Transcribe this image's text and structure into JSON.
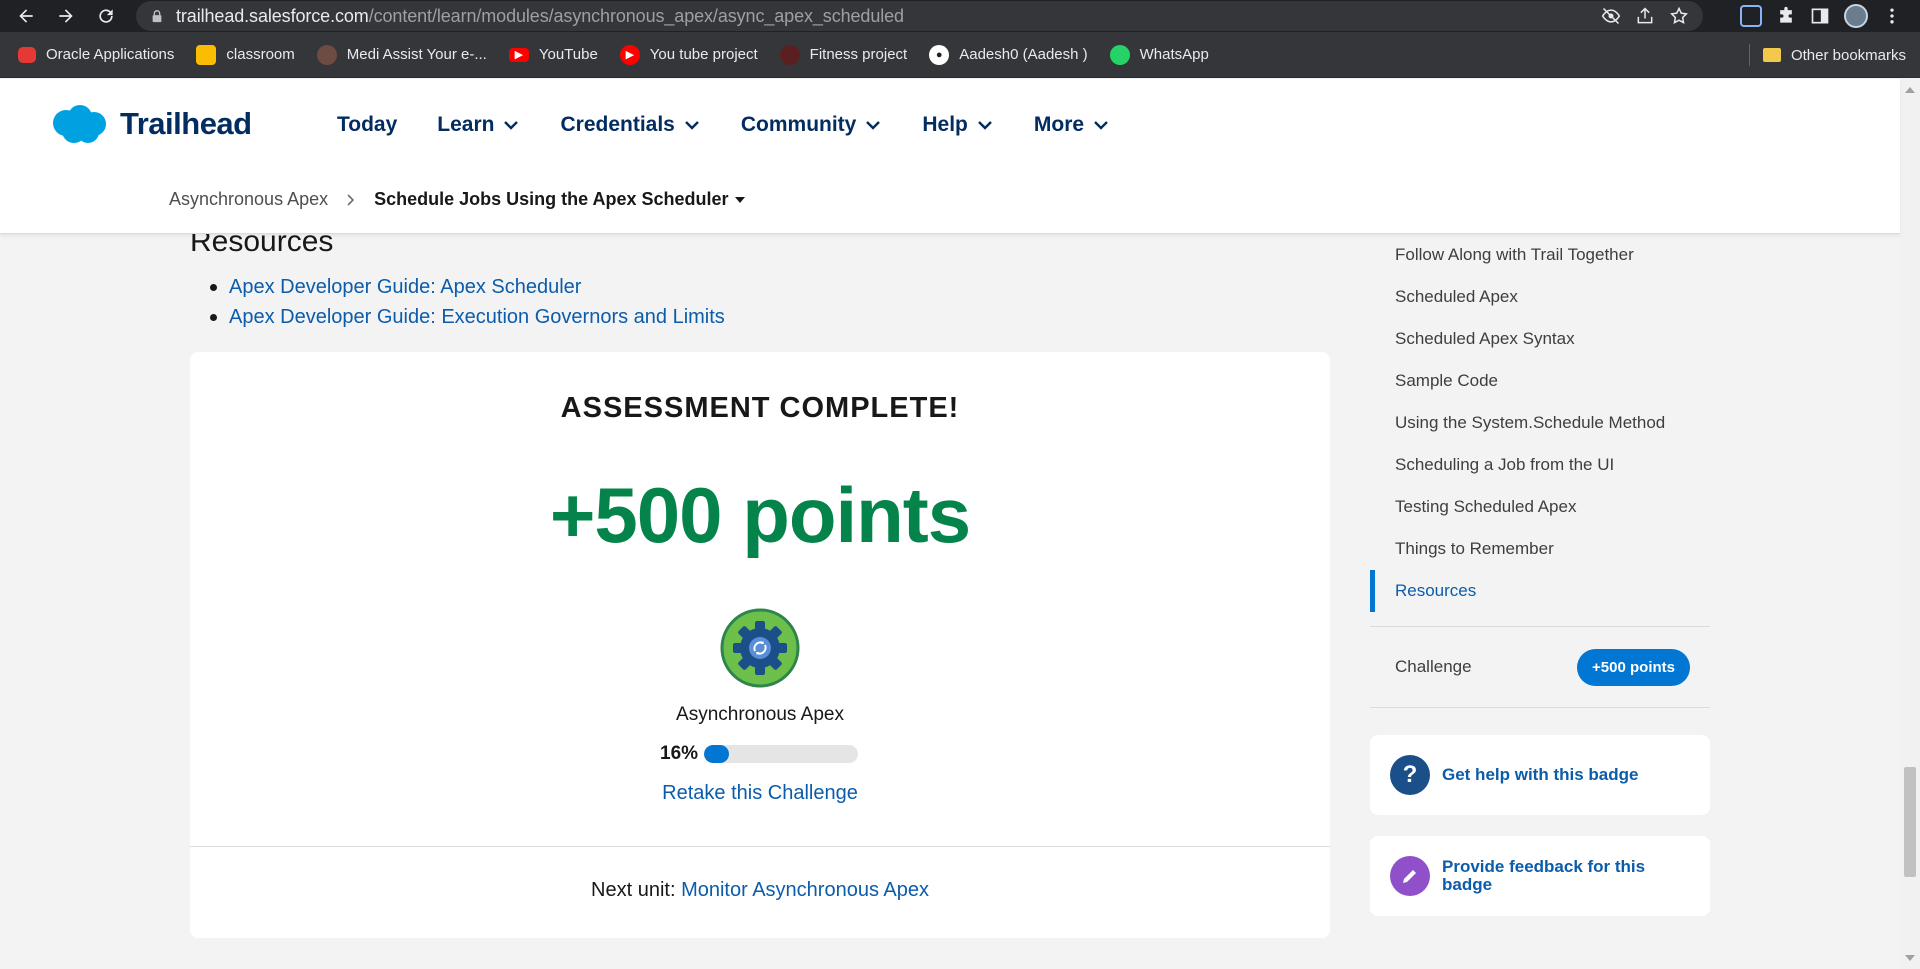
{
  "browser": {
    "url_host": "trailhead.salesforce.com",
    "url_path": "/content/learn/modules/asynchronous_apex/async_apex_scheduled",
    "bookmarks": [
      {
        "label": "Oracle Applications",
        "color": "#e53935"
      },
      {
        "label": "classroom",
        "color": "#fbbc04"
      },
      {
        "label": "Medi Assist Your e-...",
        "color": "#6d4c41"
      },
      {
        "label": "YouTube",
        "color": "#ff0000"
      },
      {
        "label": "You tube project",
        "color": "#ff0000"
      },
      {
        "label": "Fitness project",
        "color": "#b71c1c"
      },
      {
        "label": "Aadesh0 (Aadesh )",
        "color": "#ffffff"
      },
      {
        "label": "WhatsApp",
        "color": "#25d366"
      }
    ],
    "other_bookmarks": "Other bookmarks"
  },
  "header": {
    "logo_text": "Trailhead",
    "nav": [
      "Today",
      "Learn",
      "Credentials",
      "Community",
      "Help",
      "More"
    ],
    "breadcrumb": {
      "parent": "Asynchronous Apex",
      "current": "Schedule Jobs Using the Apex Scheduler"
    }
  },
  "content": {
    "resources_title": "Resources",
    "resources": [
      "Apex Developer Guide: Apex Scheduler",
      "Apex Developer Guide: Execution Governors and Limits"
    ],
    "card": {
      "title": "ASSESSMENT COMPLETE!",
      "points": "+500 points",
      "badge_name": "Asynchronous Apex",
      "progress_label": "16%",
      "progress_value": 0.16,
      "retake": "Retake this Challenge",
      "next_unit_label": "Next unit:",
      "next_unit_link": "Monitor Asynchronous Apex"
    }
  },
  "sidebar": {
    "toc": [
      "Follow Along with Trail Together",
      "Scheduled Apex",
      "Scheduled Apex Syntax",
      "Sample Code",
      "Using the System.Schedule Method",
      "Scheduling a Job from the UI",
      "Testing Scheduled Apex",
      "Things to Remember",
      "Resources"
    ],
    "active_index": 8,
    "challenge_label": "Challenge",
    "challenge_points": "+500 points",
    "help_text": "Get help with this badge",
    "feedback_text": "Provide feedback for this badge"
  },
  "colors": {
    "accent": "#0176d3",
    "points_green": "#04844b",
    "navy": "#032d60"
  }
}
